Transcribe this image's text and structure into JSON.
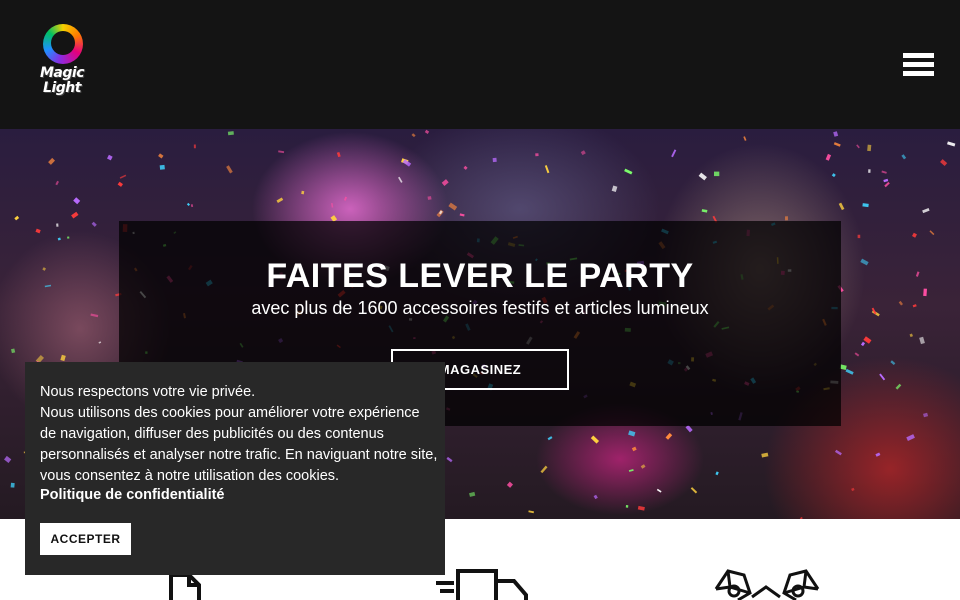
{
  "header": {
    "logo_line1": "Magic",
    "logo_line2": "Light",
    "menu_icon": "hamburger-menu-icon"
  },
  "hero": {
    "title": "FAITES LEVER LE PARTY",
    "subtitle": "avec plus de 1600 accessoires festifs et articles lumineux",
    "cta_label": "MAGASINEZ"
  },
  "features": {
    "icons": [
      "document-icon",
      "delivery-truck-icon",
      "gift-boxes-icon"
    ]
  },
  "cookie_banner": {
    "line1": "Nous respectons votre vie privée.",
    "line2": "Nous utilisons des cookies pour améliorer votre expérience de navigation, diffuser des publicités ou des contenus personnalisés et analyser notre trafic. En naviguant notre site, vous consentez à notre utilisation des cookies.",
    "policy_link": "Politique de confidentialité",
    "accept_label": "ACCEPTER"
  },
  "colors": {
    "header_bg": "#141414",
    "banner_bg": "#282828",
    "text_light": "#ffffff"
  }
}
